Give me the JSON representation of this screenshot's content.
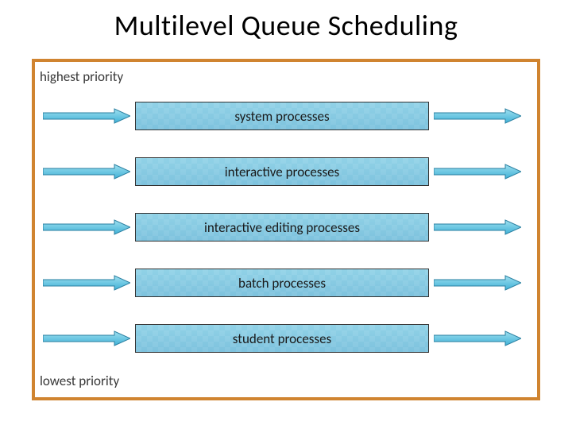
{
  "title": "Multilevel Queue Scheduling",
  "top_label": "highest priority",
  "bottom_label": "lowest priority",
  "queues": {
    "q0": "system processes",
    "q1": "interactive processes",
    "q2": "interactive editing processes",
    "q3": "batch processes",
    "q4": "student processes"
  },
  "colors": {
    "frame_border": "#d08430",
    "arrow_fill_light": "#7fd0e8",
    "arrow_fill_dark": "#3fb0d6",
    "arrow_stroke": "#2a7fa0"
  }
}
